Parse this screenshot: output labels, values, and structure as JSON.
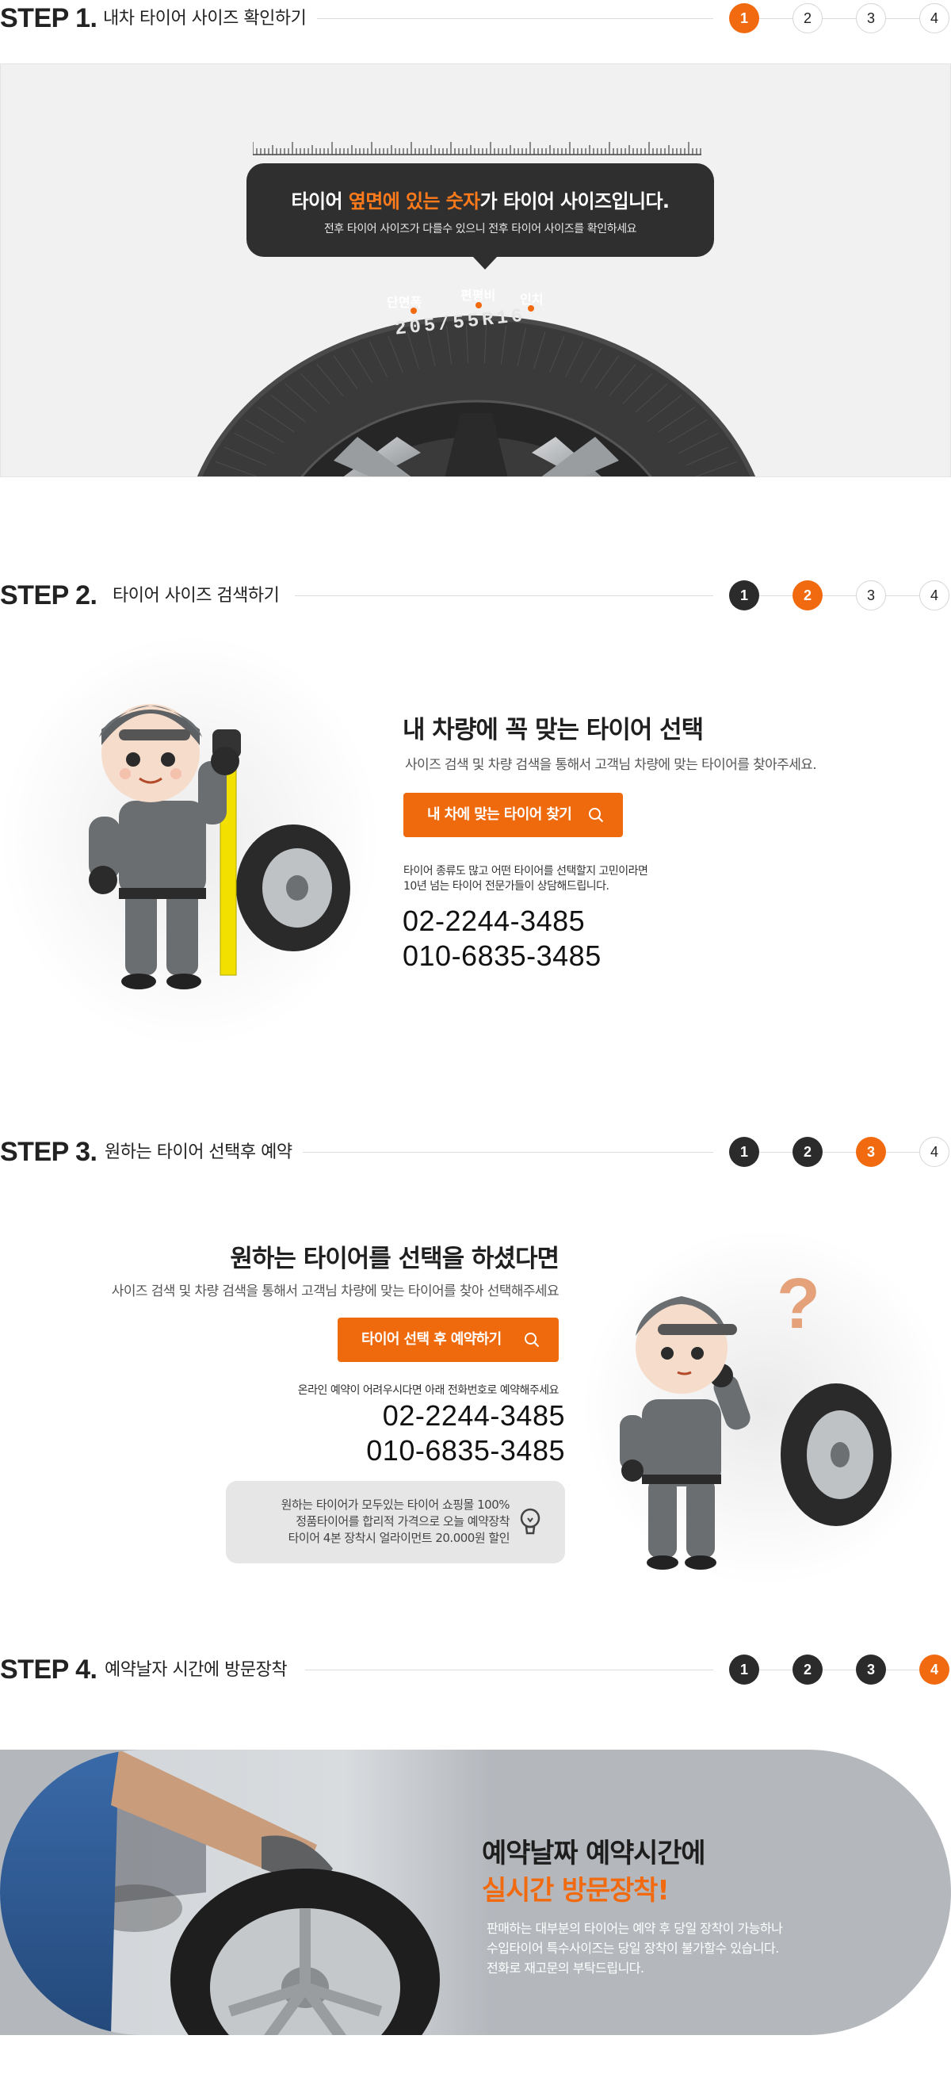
{
  "step1": {
    "label": "STEP 1.",
    "title": "내차 타이어 사이즈 확인하기",
    "dots": [
      "1",
      "2",
      "3",
      "4"
    ],
    "bubble": {
      "title_part1": "타이어 ",
      "title_highlight": "옆면에 있는 숫자",
      "title_part2": "가 타이어 사이즈입니다.",
      "subtitle": "전후 타이어 사이즈가 다를수 있으니 전후 타이어 사이즈를 확인하세요"
    },
    "tyre_labels": [
      "단면폭",
      "편평비",
      "인치"
    ],
    "tyre_size": "205/55R16"
  },
  "step2": {
    "label": "STEP 2.",
    "title": "타이어 사이즈 검색하기",
    "dots": [
      "1",
      "2",
      "3",
      "4"
    ],
    "heading": "내 차량에 꼭 맞는 타이어 선택",
    "subheading": "사이즈 검색 및 차량 검색을 통해서 고객님 차량에 맞는 타이어를 찾아주세요.",
    "cta_label": "내 차에 맞는 타이어 찾기",
    "note_line1": "타이어 종류도 많고 어떤 타이어를 선택할지 고민이라면",
    "note_line2": "10년 넘는 타이어 전문가들이 상담해드립니다.",
    "phone1": "02-2244-3485",
    "phone2": "010-6835-3485"
  },
  "step3": {
    "label": "STEP 3.",
    "title": "원하는 타이어 선택후 예약",
    "dots": [
      "1",
      "2",
      "3",
      "4"
    ],
    "heading": "원하는 타이어를 선택을 하셨다면",
    "subheading": "사이즈 검색 및 차량 검색을 통해서 고객님 차량에 맞는 타이어를 찾아 선택해주세요",
    "cta_label": "타이어 선택 후 예약하기",
    "note": "온라인 예약이 어려우시다면 아래 전화번호로 예약해주세요",
    "phone1": "02-2244-3485",
    "phone2": "010-6835-3485",
    "info_line1": "원하는 타이어가 모두있는 타이어 쇼핑몰 100%",
    "info_line2": "정품타이어를 합리적 가격으로 오늘 예약장착",
    "info_line3": "타이어 4본 장착시 얼라이먼트 20.000원 할인"
  },
  "step4": {
    "label": "STEP 4.",
    "title": "예약날자 시간에 방문장착",
    "dots": [
      "1",
      "2",
      "3",
      "4"
    ],
    "heading1": "예약날짜 예약시간에",
    "heading2": "실시간 방문장착!",
    "desc_line1": "판매하는 대부분의 타이어는 예약 후 당일 장착이 가능하나",
    "desc_line2": "수입타이어 특수사이즈는 당일 장착이 불가할수 있습니다.",
    "desc_line3": "전화로 재고문의 부탁드립니다."
  },
  "colors": {
    "accent": "#f26a10",
    "dark": "#2b2b2b",
    "bubble": "#2f2f2f",
    "panel": "#f1f1f1",
    "banner": "#b4b8bd"
  },
  "icons": [
    "search-icon",
    "lightbulb-icon",
    "question-mark-icon",
    "tyre-icon",
    "mechanic-character",
    "measuring-tape-icon"
  ]
}
